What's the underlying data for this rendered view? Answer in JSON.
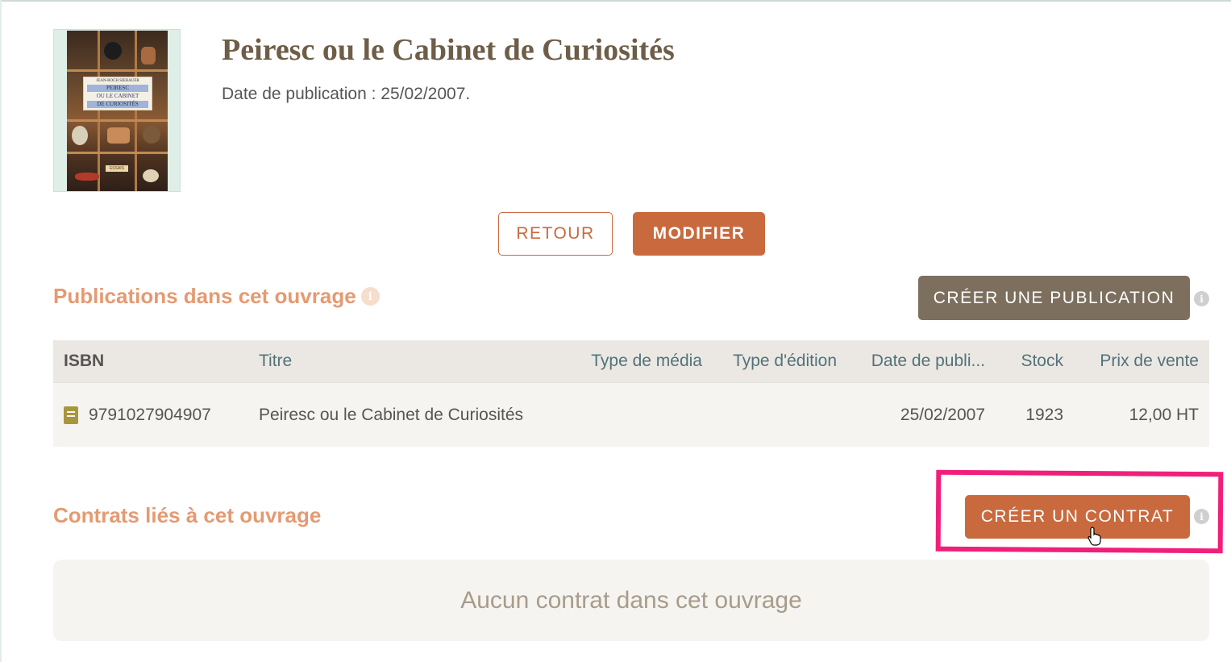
{
  "book": {
    "title": "Peiresc ou le Cabinet de Curiosités",
    "publication_date": "Date de publication : 25/02/2007.",
    "cover": {
      "author": "JEAN-ROCH SIEBAUER",
      "title_lines": [
        "PEIRESC",
        "OU LE CABINET",
        "DE CURIOSITÉS"
      ],
      "collection": "ESSAIS"
    }
  },
  "actions": {
    "back_label": "RETOUR",
    "edit_label": "MODIFIER"
  },
  "publications": {
    "section_title": "Publications dans cet ouvrage",
    "create_label": "CRÉER UNE PUBLICATION",
    "columns": [
      "ISBN",
      "Titre",
      "Type de média",
      "Type d'édition",
      "Date de publi...",
      "Stock",
      "Prix de vente"
    ],
    "rows": [
      {
        "isbn": "9791027904907",
        "titre": "Peiresc ou le Cabinet de Curiosités",
        "type_media": "",
        "type_edition": "",
        "date": "25/02/2007",
        "stock": "1923",
        "prix": "12,00 HT"
      }
    ]
  },
  "contracts": {
    "section_title": "Contrats liés à cet ouvrage",
    "create_label": "CRÉER UN CONTRAT",
    "empty_message": "Aucun contrat dans cet ouvrage"
  },
  "icons": {
    "info": "info-icon",
    "book": "book-icon",
    "cursor": "hand-cursor-icon"
  },
  "colors": {
    "accent": "#c96a3e",
    "secondary": "#7c6f5e",
    "section_title": "#e59a72",
    "highlight": "#f0207a"
  }
}
